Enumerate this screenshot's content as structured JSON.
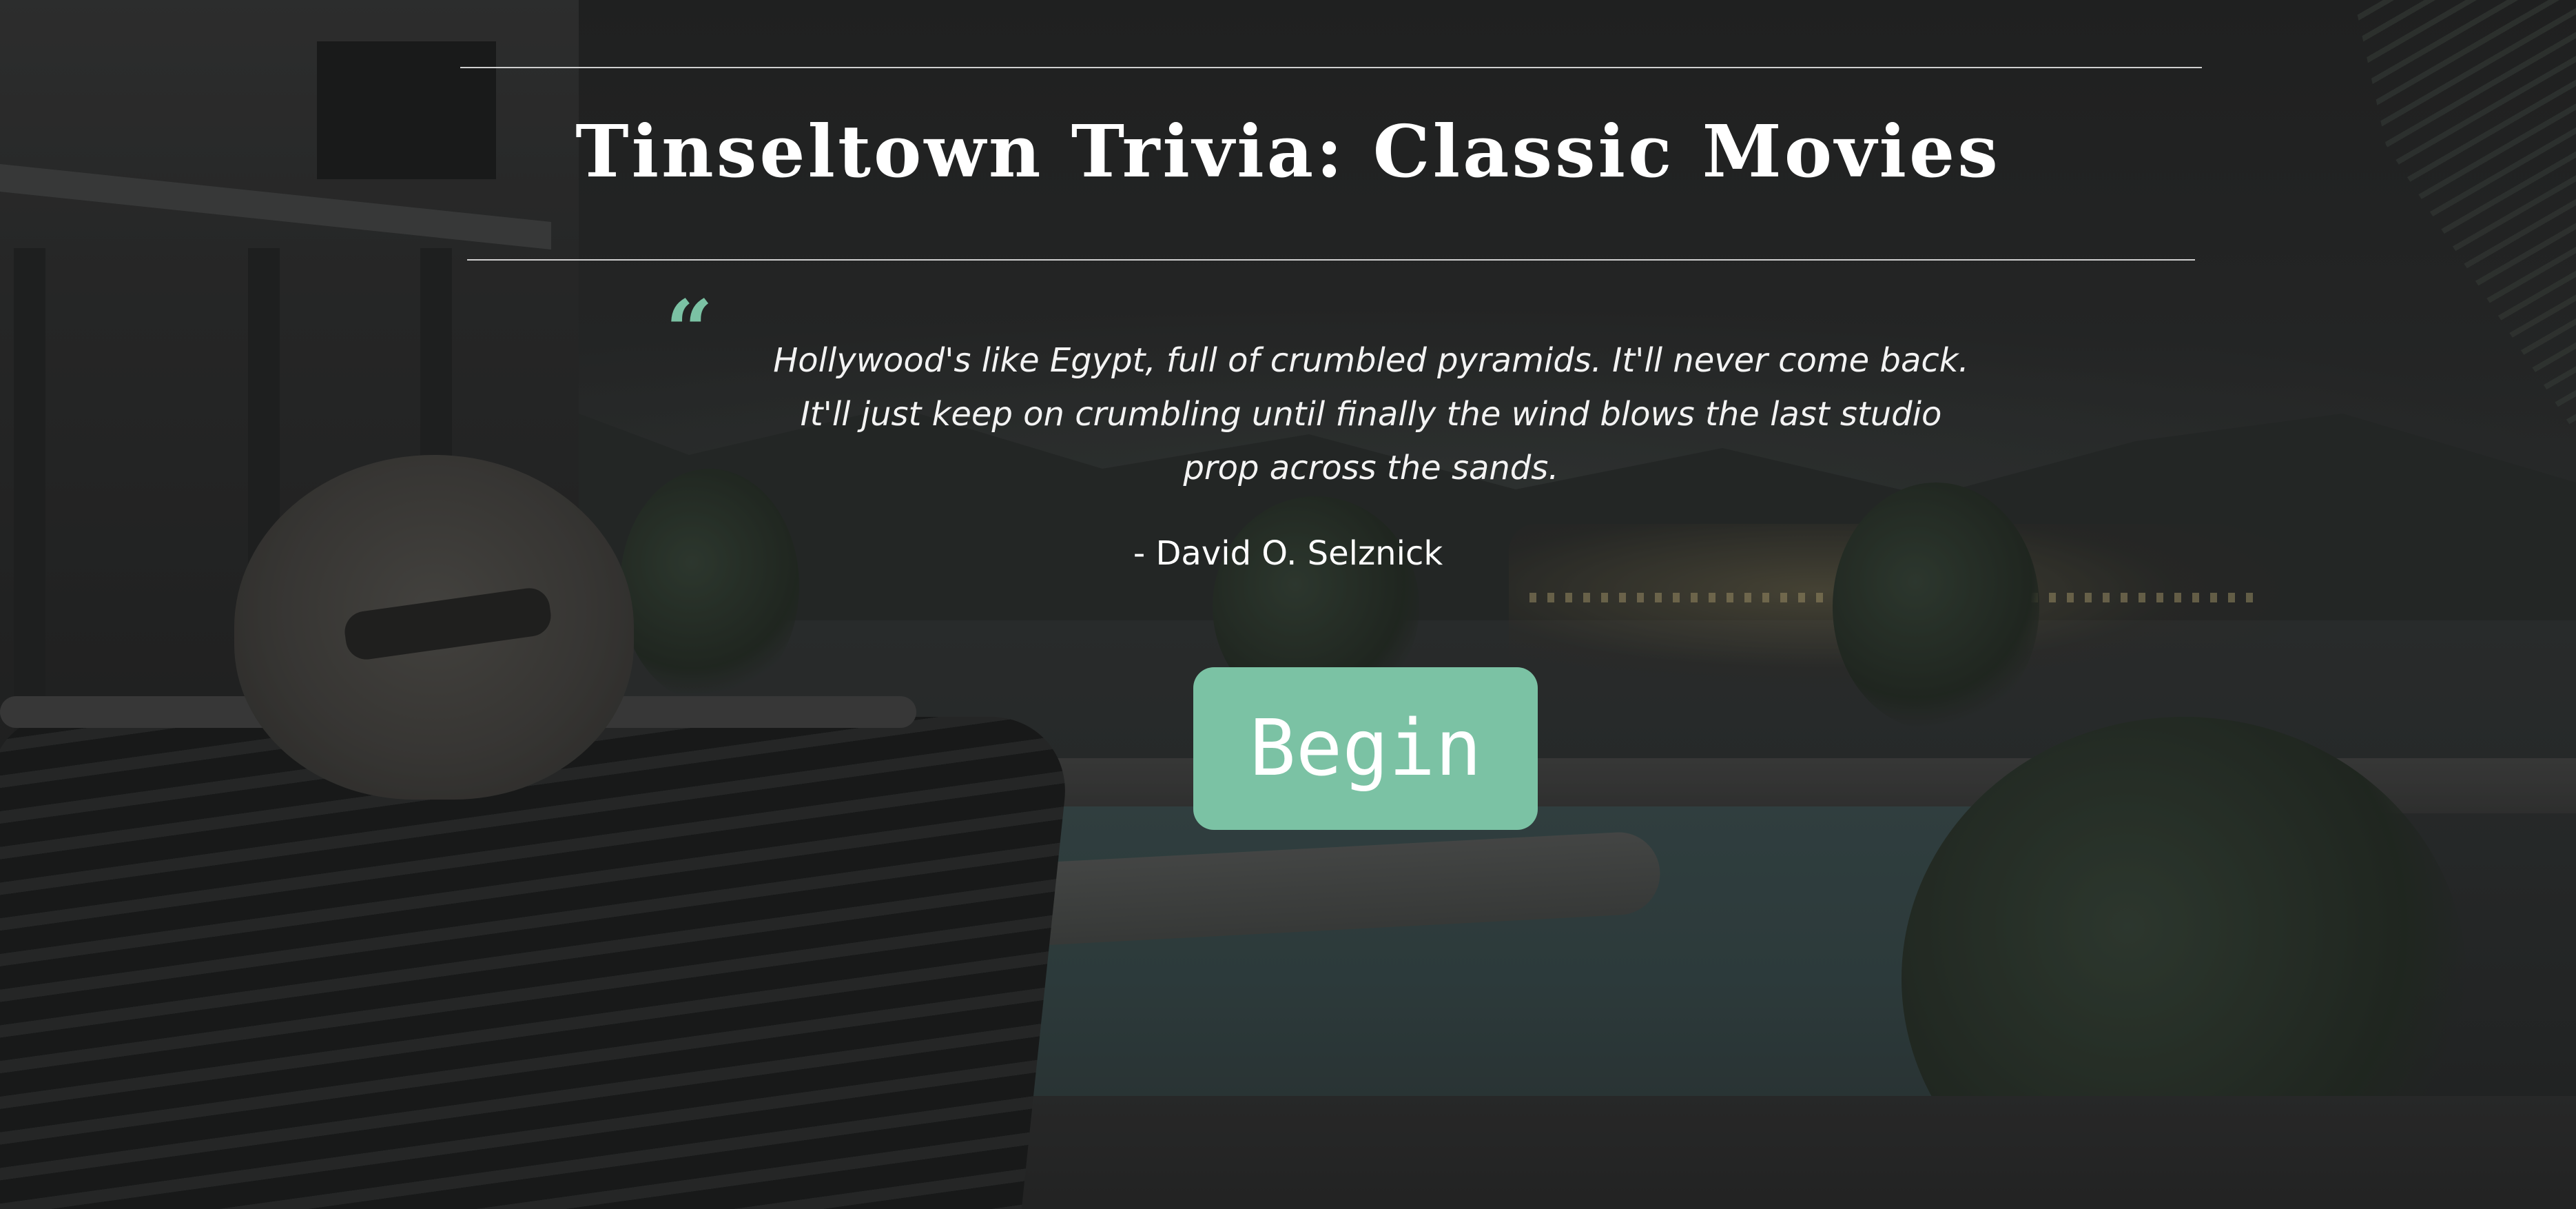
{
  "header": {
    "title": "Tinseltown Trivia: Classic Movies"
  },
  "quote": {
    "mark": "“",
    "text": "Hollywood's like Egypt, full of crumbled pyramids. It'll never come back. It'll just keep on crumbling until finally the wind blows the last studio prop across the sands.",
    "attribution": "- David O. Selznick"
  },
  "actions": {
    "begin_label": "Begin"
  },
  "colors": {
    "accent": "#7bc2a4",
    "text": "#ffffff",
    "rule": "#cfcfcf"
  },
  "icons": {
    "quote": "opening-quote-icon"
  }
}
